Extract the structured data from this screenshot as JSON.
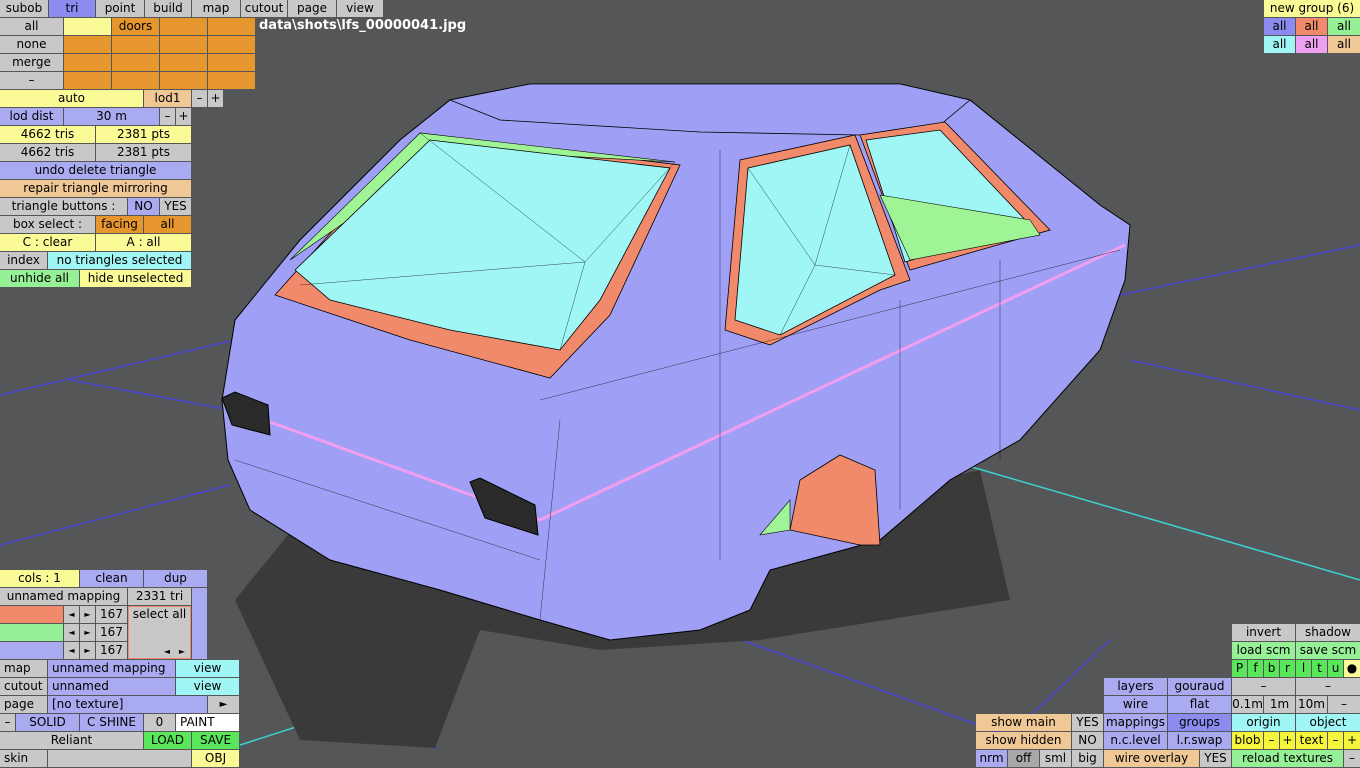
{
  "file_path": "data\\shots\\lfs_00000041.jpg",
  "tabs": [
    "subob",
    "tri",
    "point",
    "build",
    "map",
    "cutout",
    "page",
    "view"
  ],
  "active_tab": "tri",
  "group_panel": {
    "rows": [
      "all",
      "none",
      "merge",
      "–"
    ],
    "doors_label": "doors"
  },
  "lod": {
    "auto": "auto",
    "lod1": "lod1",
    "minus": "–",
    "plus": "+",
    "dist_label": "lod dist",
    "dist_value": "30 m"
  },
  "stats": {
    "tris1": "4662 tris",
    "pts1": "2381 pts",
    "tris2": "4662 tris",
    "pts2": "2381 pts"
  },
  "actions": {
    "undo_delete": "undo delete triangle",
    "repair_mirroring": "repair triangle mirroring",
    "triangle_buttons": "triangle buttons :",
    "no": "NO",
    "yes": "YES",
    "box_select": "box select :",
    "facing": "facing",
    "all": "all",
    "c_clear": "C : clear",
    "a_all": "A : all",
    "index": "index",
    "no_selected": "no triangles selected",
    "unhide_all": "unhide all",
    "hide_unselected": "hide unselected"
  },
  "new_group": {
    "label": "new group (6)",
    "cells": [
      "all",
      "all",
      "all",
      "all",
      "all",
      "all"
    ]
  },
  "mapping_panel": {
    "cols": "cols : 1",
    "clean": "clean",
    "dup": "dup",
    "name": "unnamed mapping",
    "tri_count": "2331 tri",
    "select_all": "select all",
    "rows": [
      "167",
      "167",
      "167"
    ],
    "arrow_left": "◄",
    "arrow_right": "►"
  },
  "map_rows": {
    "map_label": "map",
    "map_value": "unnamed mapping",
    "map_view": "view",
    "cutout_label": "cutout",
    "cutout_value": "unnamed",
    "cutout_view": "view",
    "page_label": "page",
    "page_value": "[no texture]",
    "page_arrow": "►",
    "dash": "–",
    "solid": "SOLID",
    "cshine": "C SHINE",
    "zero": "0",
    "paint": "PAINT",
    "skin_name": "Reliant",
    "load": "LOAD",
    "save": "SAVE",
    "skin_label": "skin",
    "obj": "OBJ"
  },
  "view_panel": {
    "invert": "invert",
    "shadow": "shadow",
    "load_scm": "load scm",
    "save_scm": "save scm",
    "letters": [
      "P",
      "f",
      "b",
      "r",
      "l",
      "t",
      "u",
      "●"
    ],
    "layers": "layers",
    "gouraud": "gouraud",
    "minus": "–",
    "wire": "wire",
    "flat": "flat",
    "d01": "0.1m",
    "d1": "1m",
    "d10": "10m",
    "mappings": "mappings",
    "groups": "groups",
    "origin": "origin",
    "object": "object",
    "show_main": "show main",
    "show_main_val": "YES",
    "nc_level": "n.c.level",
    "lr_swap": "l.r.swap",
    "blob": "blob",
    "text": "text",
    "plus": "+",
    "show_hidden": "show hidden",
    "show_hidden_val": "NO",
    "nrm": "nrm",
    "off": "off",
    "sml": "sml",
    "big": "big",
    "wire_overlay": "wire overlay",
    "wire_overlay_val": "YES",
    "reload_textures": "reload textures"
  }
}
